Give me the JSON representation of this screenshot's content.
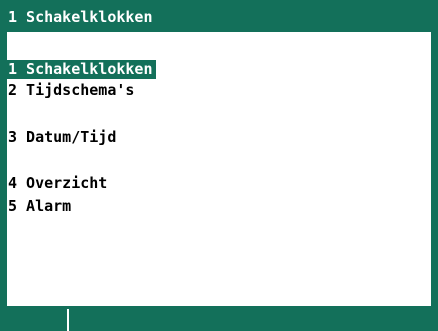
{
  "title": "1 Schakelklokken",
  "menu": {
    "selected_index": 0,
    "items": [
      {
        "label": "1 Schakelklokken"
      },
      {
        "label": "2 Tijdschema's"
      },
      {
        "label": "3 Datum/Tijd"
      },
      {
        "label": "4 Overzicht"
      },
      {
        "label": "5 Alarm"
      }
    ]
  },
  "colors": {
    "accent": "#13705a",
    "background": "#ffffff",
    "text": "#000000"
  }
}
